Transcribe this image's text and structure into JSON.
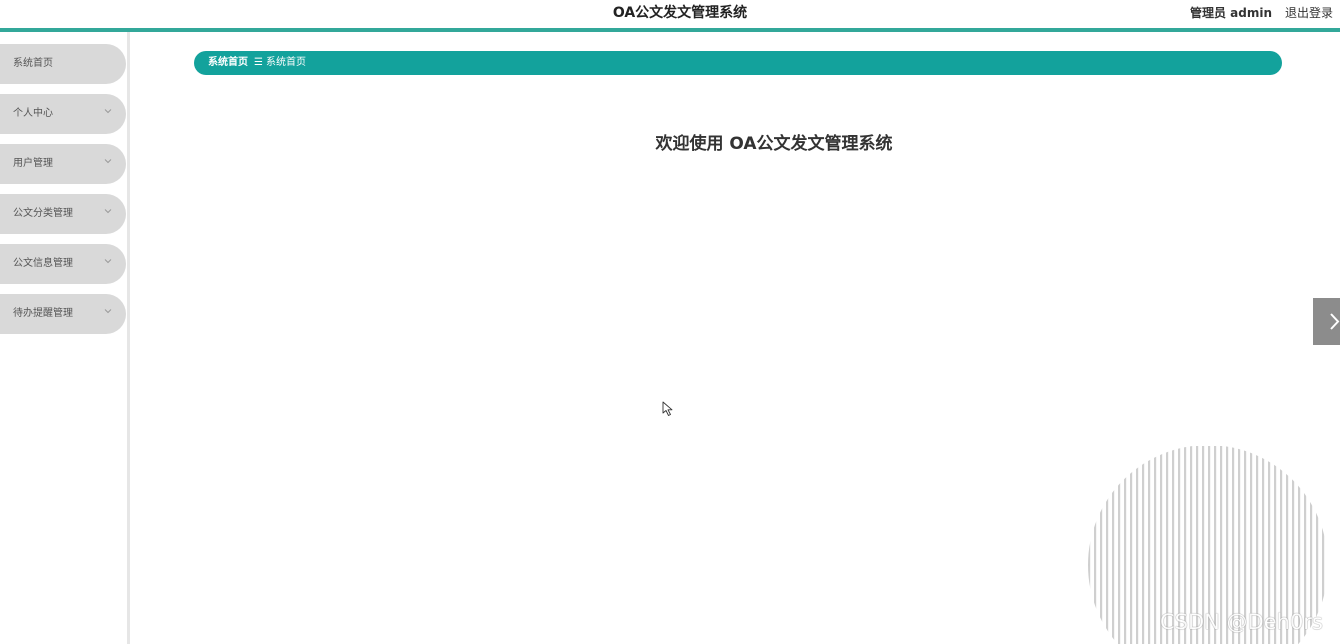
{
  "header": {
    "title": "OA公文发文管理系统",
    "user_label": "管理员 admin",
    "logout_label": "退出登录"
  },
  "sidebar": {
    "items": [
      {
        "label": "系统首页",
        "has_chevron": false
      },
      {
        "label": "个人中心",
        "has_chevron": true
      },
      {
        "label": "用户管理",
        "has_chevron": true
      },
      {
        "label": "公文分类管理",
        "has_chevron": true
      },
      {
        "label": "公文信息管理",
        "has_chevron": true
      },
      {
        "label": "待办提醒管理",
        "has_chevron": true
      }
    ]
  },
  "breadcrumb": {
    "home": "系统首页",
    "separator": "☰",
    "current": "系统首页"
  },
  "main": {
    "welcome": "欢迎使用 OA公文发文管理系统"
  },
  "watermark": "CSDN @Deh0rs",
  "colors": {
    "accent": "#13a29c",
    "header_line": "#33a89a",
    "nav_bg": "#d9d9d9",
    "side_tab": "#8c8c8c"
  }
}
